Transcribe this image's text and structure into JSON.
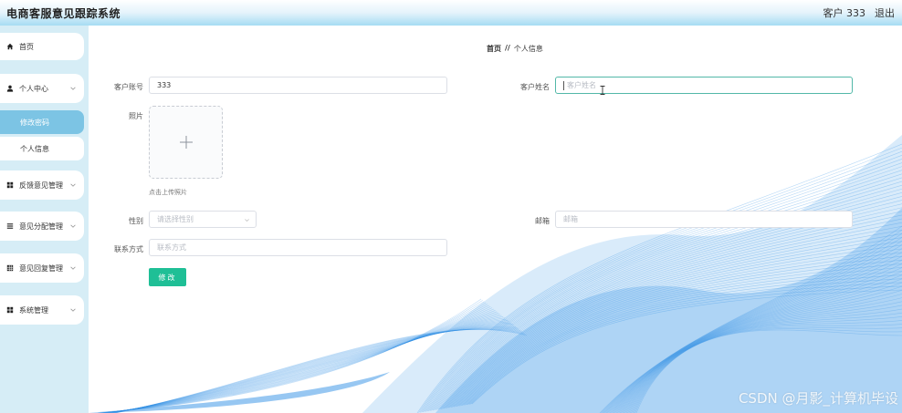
{
  "header": {
    "title": "电商客服意见跟踪系统",
    "user_label": "客户 333",
    "logout_label": "退出"
  },
  "sidebar": {
    "items": [
      {
        "label": "首页",
        "icon": "home-icon"
      },
      {
        "label": "个人中心",
        "icon": "user-icon",
        "children": [
          {
            "label": "修改密码",
            "active": true
          },
          {
            "label": "个人信息",
            "active": false
          }
        ]
      },
      {
        "label": "反馈意见管理",
        "icon": "grid-icon"
      },
      {
        "label": "意见分配管理",
        "icon": "list-icon"
      },
      {
        "label": "意见回复管理",
        "icon": "table-icon"
      },
      {
        "label": "系统管理",
        "icon": "grid-icon"
      }
    ]
  },
  "breadcrumb": {
    "home": "首页",
    "separator": "//",
    "current": "个人信息"
  },
  "form": {
    "account_label": "客户账号",
    "account_value": "333",
    "name_label": "客户姓名",
    "name_placeholder": "客户姓名",
    "photo_label": "照片",
    "upload_hint": "点击上传照片",
    "gender_label": "性别",
    "gender_placeholder": "请选择性别",
    "email_label": "邮箱",
    "email_placeholder": "邮箱",
    "phone_label": "联系方式",
    "phone_placeholder": "联系方式",
    "submit_label": "修改"
  },
  "watermark": "CSDN @月影_计算机毕设",
  "colors": {
    "header_gradient_end": "#a6dcf3",
    "sidebar_bg": "#d6edf6",
    "active_submenu": "#7cc4e4",
    "submit_button": "#1fbf96",
    "focus_border": "#52b8a8",
    "wave_blue": "#2f8fe6"
  }
}
